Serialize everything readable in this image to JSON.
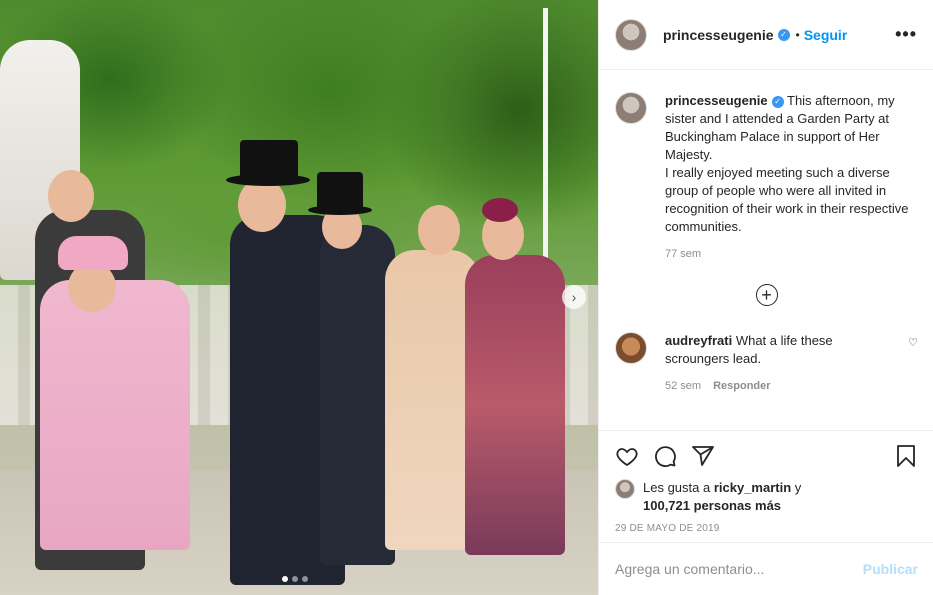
{
  "post": {
    "username": "princesseugenie",
    "verified_icon": "verified-badge-icon",
    "separator": "•",
    "follow_label": "Seguir",
    "more_icon": "more-options-icon",
    "more_glyph": "•••"
  },
  "caption": {
    "username": "princesseugenie",
    "text": "This afternoon, my sister and I attended a Garden Party at Buckingham Palace in support of Her Majesty.",
    "text2": "I really enjoyed meeting such a diverse group of people who were all invited in recognition of their work in their respective communities.",
    "time": "77 sem"
  },
  "load_more_icon": "plus-circle-icon",
  "load_more_glyph": "+",
  "comments": [
    {
      "username": "audreyfrati",
      "text": "What a life these scroungers lead.",
      "time": "52 sem",
      "reply_label": "Responder",
      "like_glyph": "♡"
    }
  ],
  "actions": {
    "like_icon": "heart-icon",
    "comment_icon": "comment-bubble-icon",
    "share_icon": "paper-plane-icon",
    "save_icon": "bookmark-icon"
  },
  "likes": {
    "prefix": "Les gusta a",
    "user": "ricky_martin",
    "middle": "y",
    "count": "100,721 personas más"
  },
  "date": "29 DE MAYO DE 2019",
  "add_comment": {
    "placeholder": "Agrega un comentario...",
    "publish_label": "Publicar"
  },
  "carousel": {
    "next_glyph": "›",
    "slides": 3,
    "active_slide": 1
  },
  "colors": {
    "link_blue": "#0095f6",
    "verified": "#3897f0",
    "publish_disabled": "#b2dffc"
  }
}
